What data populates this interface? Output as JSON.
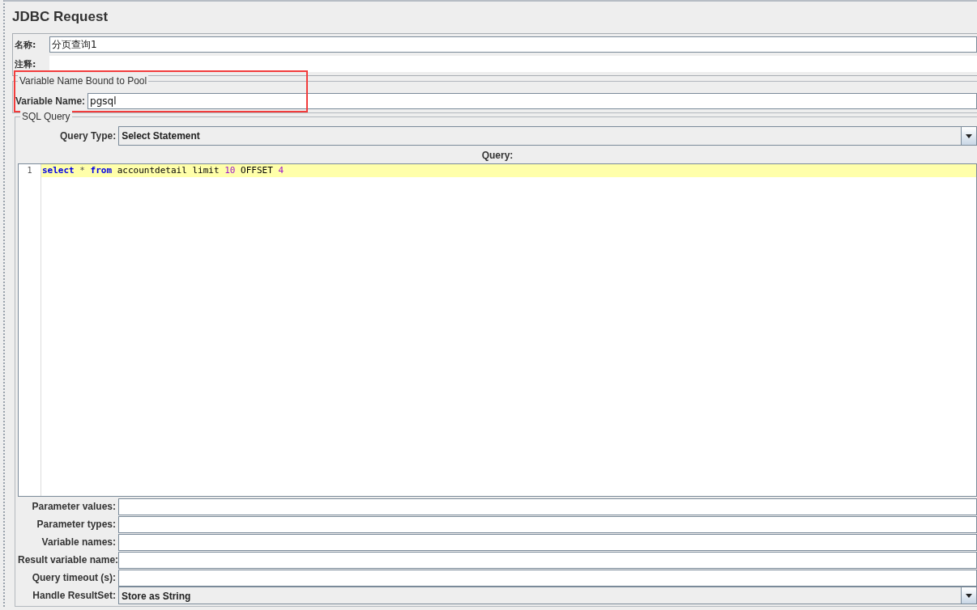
{
  "title": "JDBC Request",
  "name_field": {
    "label": "名称:",
    "value": "分页查询1"
  },
  "comment_field": {
    "label": "注释:"
  },
  "pool_group": {
    "legend": "Variable Name Bound to Pool",
    "label": "Variable Name:",
    "value": "pgsql",
    "highlighted": true
  },
  "sql_group": {
    "legend": "SQL Query",
    "query_type": {
      "label": "Query Type:",
      "value": "Select Statement"
    },
    "query_label": "Query:",
    "editor": {
      "lines": [
        {
          "number": "1",
          "current": true,
          "tokens": [
            {
              "text": "select ",
              "kind": "keyword"
            },
            {
              "text": "* ",
              "kind": "operator"
            },
            {
              "text": "from",
              "kind": "keyword"
            },
            {
              "text": " accountdetail limit ",
              "kind": "plain"
            },
            {
              "text": "10",
              "kind": "number"
            },
            {
              "text": " OFFSET ",
              "kind": "plain"
            },
            {
              "text": "4",
              "kind": "number"
            }
          ]
        }
      ]
    },
    "fields": [
      {
        "label": "Parameter values:",
        "kind": "text"
      },
      {
        "label": "Parameter types:",
        "kind": "text"
      },
      {
        "label": "Variable names:",
        "kind": "text"
      },
      {
        "label": "Result variable name:",
        "kind": "text"
      },
      {
        "label": "Query timeout (s):",
        "kind": "text"
      },
      {
        "label": "Handle ResultSet:",
        "kind": "dropdown",
        "value": "Store as String"
      }
    ]
  }
}
